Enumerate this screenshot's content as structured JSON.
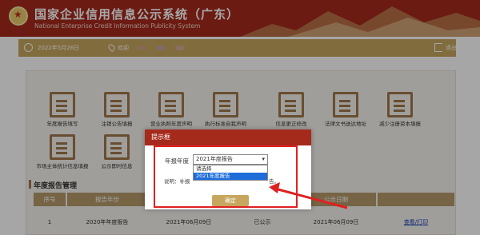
{
  "header": {
    "title": "国家企业信用信息公示系统（广东）",
    "subtitle": "National Enterprise Credit Information Publicity System"
  },
  "toolbar": {
    "date": "2022年5月26日",
    "welcome": "欢迎",
    "logout": "退出登录"
  },
  "tiles_row1": [
    {
      "label": "年度报告填写",
      "icon": "edit-icon"
    },
    {
      "label": "注销公告填报",
      "icon": "tray-icon"
    },
    {
      "label": "营业执照年度声明",
      "icon": "document-icon"
    },
    {
      "label": "执行标准自我声明",
      "icon": "document-icon"
    },
    {
      "label": "信息更正修改",
      "icon": "edit-icon"
    },
    {
      "label": "法律文书送达地址",
      "icon": "document-icon"
    },
    {
      "label": "减少注册资本填报",
      "icon": "document-icon"
    }
  ],
  "tiles_row2": [
    {
      "label": "市场主体统计信息填报",
      "icon": "document-icon"
    },
    {
      "label": "公示即时信息",
      "icon": "document-icon"
    },
    {
      "label": "公示即时信息",
      "icon": "document-icon"
    }
  ],
  "section": {
    "title": "年度报告管理"
  },
  "table": {
    "headers": [
      "序号",
      "报告年份",
      "",
      "",
      "公示日期",
      ""
    ],
    "row": [
      "1",
      "2020年年度报告",
      "2021年06月09日",
      "已公示",
      "2021年06月09日",
      "查看/打印"
    ]
  },
  "modal": {
    "title": "提示框",
    "field_label": "年报年度",
    "selected": "2021年度报告",
    "options": [
      "请选择",
      "2021年度报告"
    ],
    "note": "说明：补报",
    "note_tail": "告。",
    "ok": "确定"
  },
  "colors": {
    "brand": "#a52a1c",
    "accent": "#c7a65e",
    "highlight": "#e02020"
  }
}
